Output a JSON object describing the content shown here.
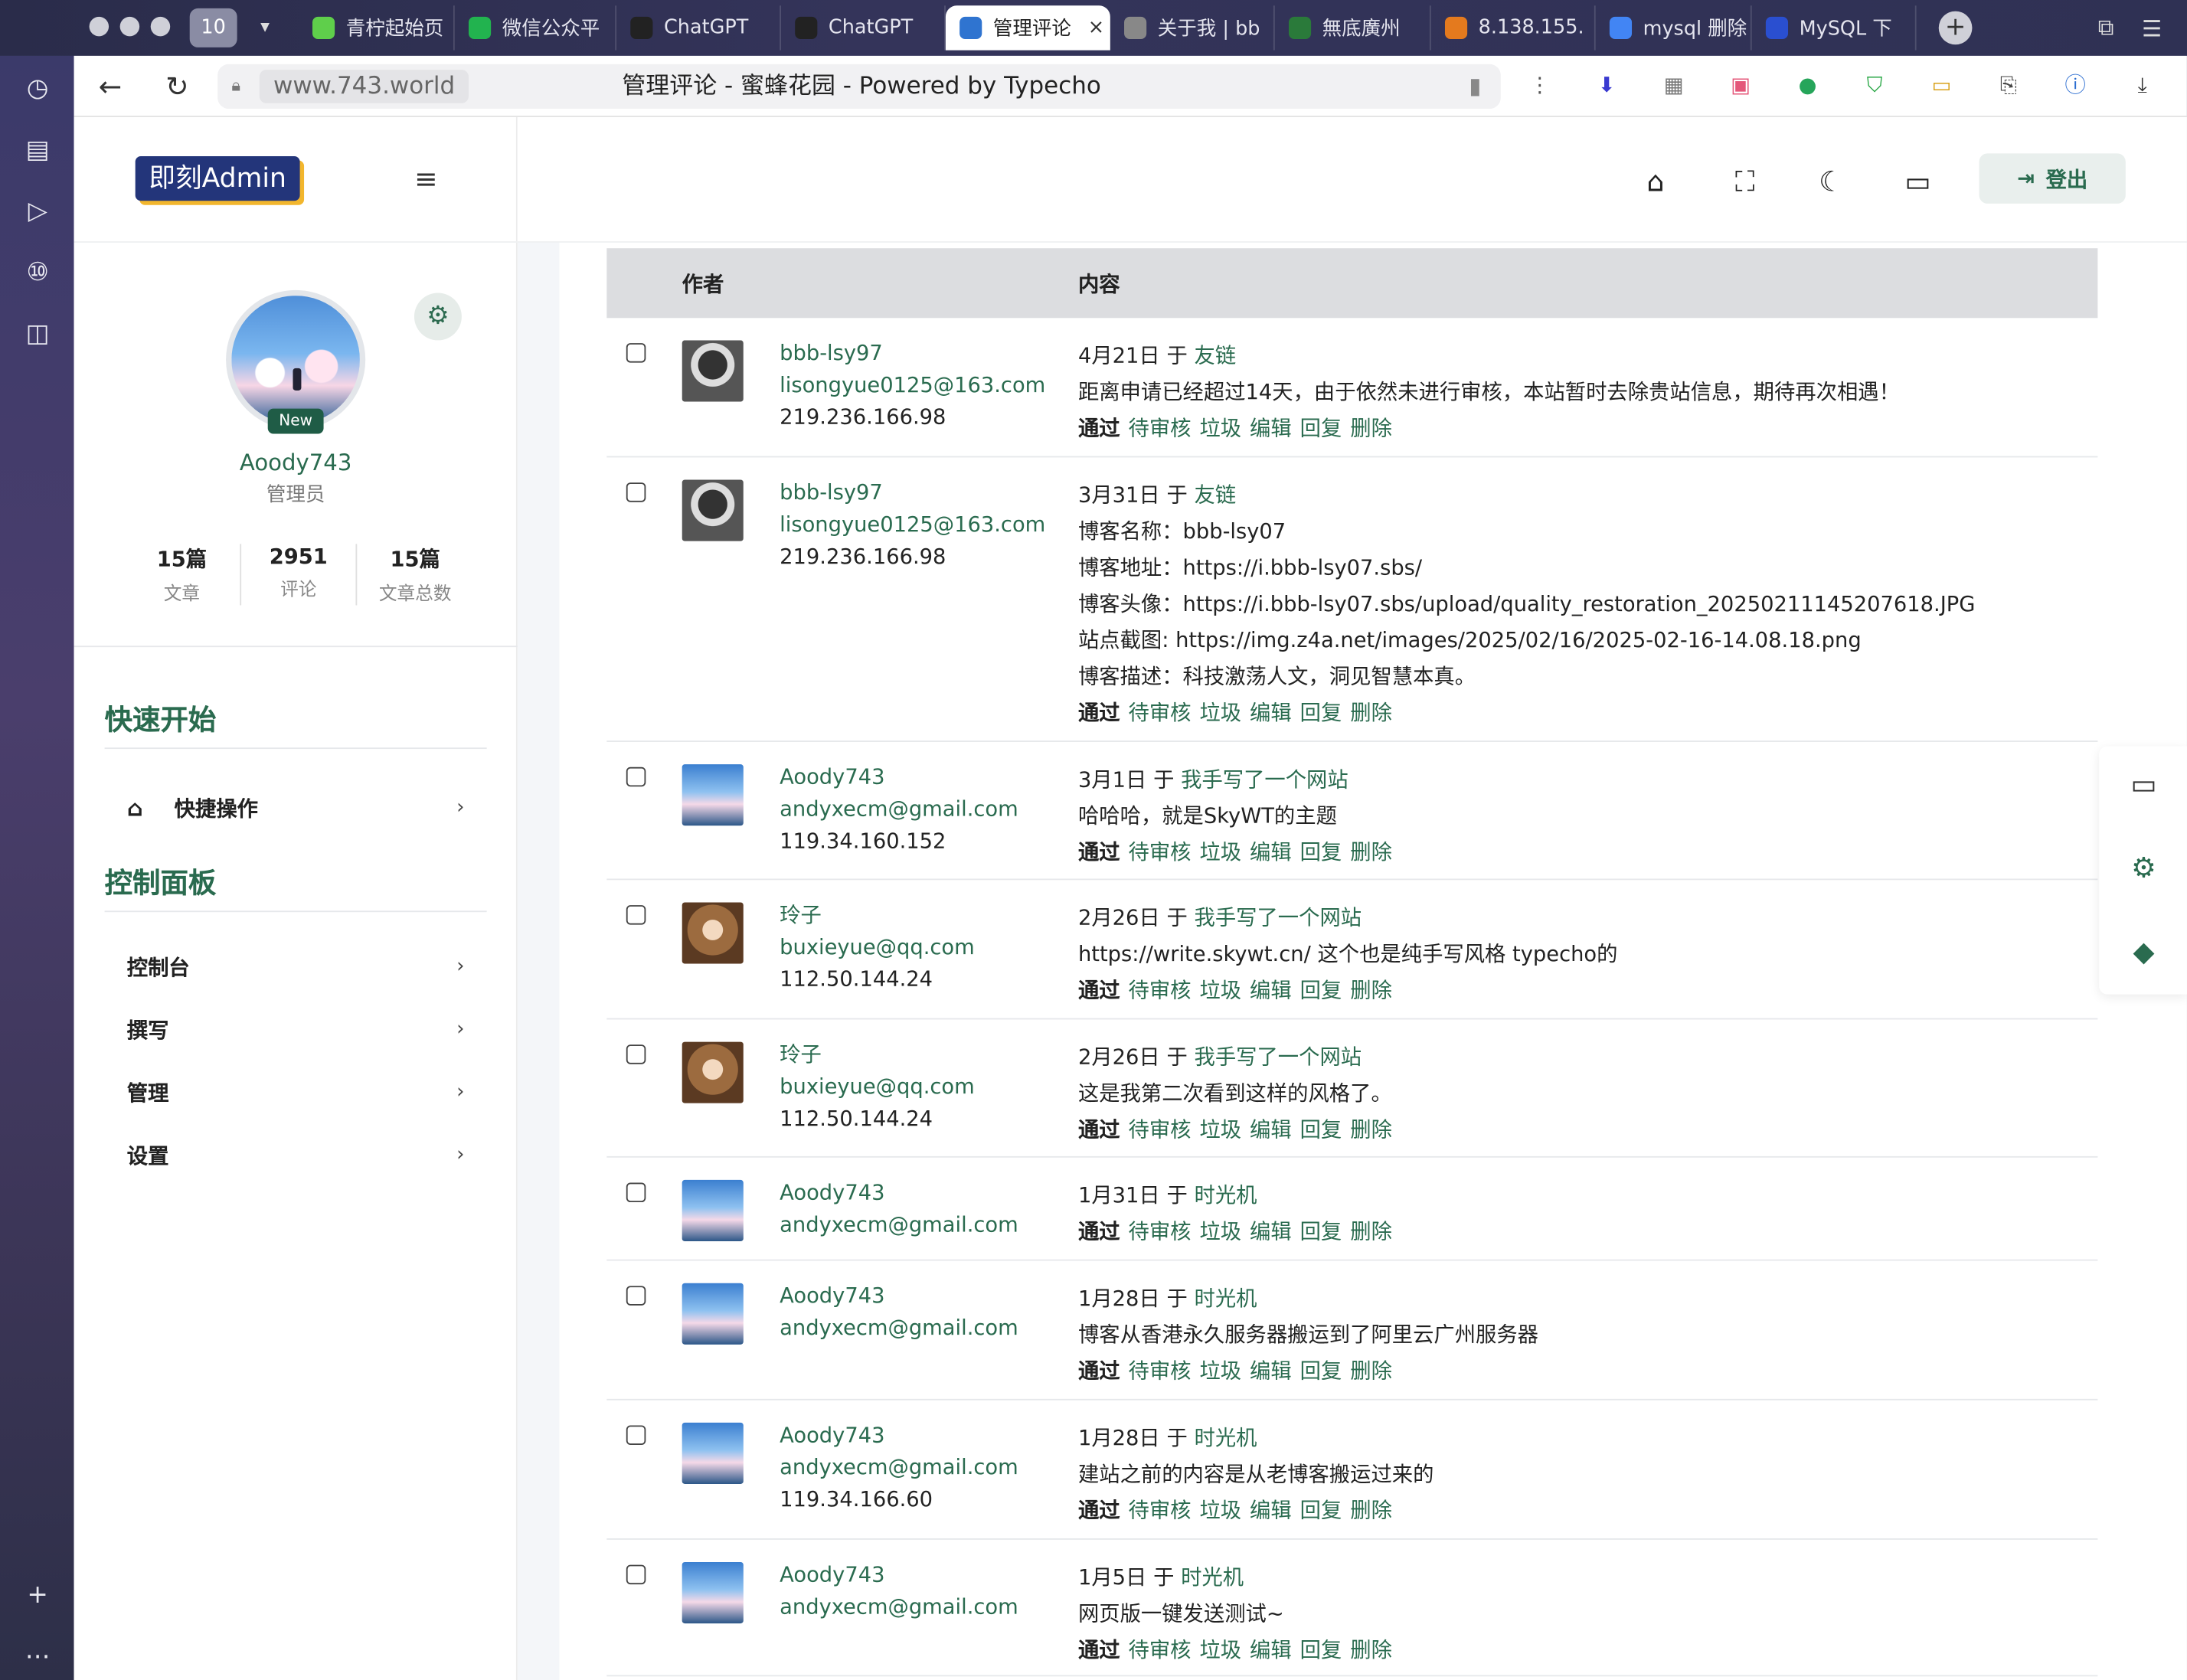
{
  "browser": {
    "tab_count": "10",
    "tabs": [
      {
        "label": "青柠起始页",
        "color": "#5fcf4b"
      },
      {
        "label": "微信公众平",
        "color": "#22b34f"
      },
      {
        "label": "ChatGPT",
        "color": "#222"
      },
      {
        "label": "ChatGPT",
        "color": "#222"
      },
      {
        "label": "管理评论",
        "color": "#2f74d0",
        "active": true
      },
      {
        "label": "关于我 | bb",
        "color": "#888"
      },
      {
        "label": "無底廣州",
        "color": "#2a7a3a"
      },
      {
        "label": "8.138.155.",
        "color": "#e47a1e"
      },
      {
        "label": "mysql 删除",
        "color": "#4285f4"
      },
      {
        "label": "MySQL 下",
        "color": "#2a4fd0"
      }
    ],
    "url_domain": "www.743.world",
    "page_title": "管理评论 - 蜜蜂花园 - Powered by Typecho"
  },
  "app": {
    "logo": "即刻Admin",
    "user": {
      "name": "Aoody743",
      "role": "管理员",
      "badge": "New"
    },
    "stats": [
      {
        "value": "15篇",
        "label": "文章"
      },
      {
        "value": "2951",
        "label": "评论"
      },
      {
        "value": "15篇",
        "label": "文章总数"
      }
    ],
    "quick_start_title": "快速开始",
    "quick_item": "快捷操作",
    "control_panel_title": "控制面板",
    "menu": [
      "控制台",
      "撰写",
      "管理",
      "设置"
    ],
    "logout_label": "登出"
  },
  "table": {
    "col_author": "作者",
    "col_content": "内容",
    "actions": {
      "pass": "通过",
      "pending": "待审核",
      "spam": "垃圾",
      "edit": "编辑",
      "reply": "回复",
      "delete": "删除"
    },
    "rows": [
      {
        "avatar": "dark",
        "name": "bbb-lsy97",
        "email": "lisongyue0125@163.com",
        "ip": "219.236.166.98",
        "date": "4月21日",
        "in": "于",
        "post": "友链",
        "lines": [
          "距离申请已经超过14天，由于依然未进行审核，本站暂时去除贵站信息，期待再次相遇！"
        ]
      },
      {
        "avatar": "dark",
        "name": "bbb-lsy97",
        "email": "lisongyue0125@163.com",
        "ip": "219.236.166.98",
        "date": "3月31日",
        "in": "于",
        "post": "友链",
        "lines": [
          "博客名称：bbb-lsy07",
          "博客地址：https://i.bbb-lsy07.sbs/",
          "博客头像：https://i.bbb-lsy07.sbs/upload/quality_restoration_20250211145207618.JPG",
          "站点截图: https://img.z4a.net/images/2025/02/16/2025-02-16-14.08.18.png",
          "博客描述：科技激荡人文，洞见智慧本真。"
        ]
      },
      {
        "avatar": "sky",
        "name": "Aoody743",
        "email": "andyxecm@gmail.com",
        "ip": "119.34.160.152",
        "date": "3月1日",
        "in": "于",
        "post": "我手写了一个网站",
        "lines": [
          "哈哈哈，就是SkyWT的主题"
        ]
      },
      {
        "avatar": "girl",
        "name": "玲子",
        "email": "buxieyue@qq.com",
        "ip": "112.50.144.24",
        "date": "2月26日",
        "in": "于",
        "post": "我手写了一个网站",
        "lines": [
          "https://write.skywt.cn/ 这个也是纯手写风格 typecho的"
        ]
      },
      {
        "avatar": "girl",
        "name": "玲子",
        "email": "buxieyue@qq.com",
        "ip": "112.50.144.24",
        "date": "2月26日",
        "in": "于",
        "post": "我手写了一个网站",
        "lines": [
          "这是我第二次看到这样的风格了。"
        ]
      },
      {
        "avatar": "sky",
        "name": "Aoody743",
        "email": "andyxecm@gmail.com",
        "ip": "",
        "date": "1月31日",
        "in": "于",
        "post": "时光机",
        "lines": []
      },
      {
        "avatar": "sky",
        "name": "Aoody743",
        "email": "andyxecm@gmail.com",
        "ip": "",
        "date": "1月28日",
        "in": "于",
        "post": "时光机",
        "lines": [
          "博客从香港永久服务器搬运到了阿里云广州服务器"
        ]
      },
      {
        "avatar": "sky",
        "name": "Aoody743",
        "email": "andyxecm@gmail.com",
        "ip": "119.34.166.60",
        "date": "1月28日",
        "in": "于",
        "post": "时光机",
        "lines": [
          "建站之前的内容是从老博客搬运过来的"
        ]
      },
      {
        "avatar": "sky",
        "name": "Aoody743",
        "email": "andyxecm@gmail.com",
        "ip": "",
        "date": "1月5日",
        "in": "于",
        "post": "时光机",
        "lines": [
          "网页版一键发送测试~"
        ]
      }
    ]
  }
}
